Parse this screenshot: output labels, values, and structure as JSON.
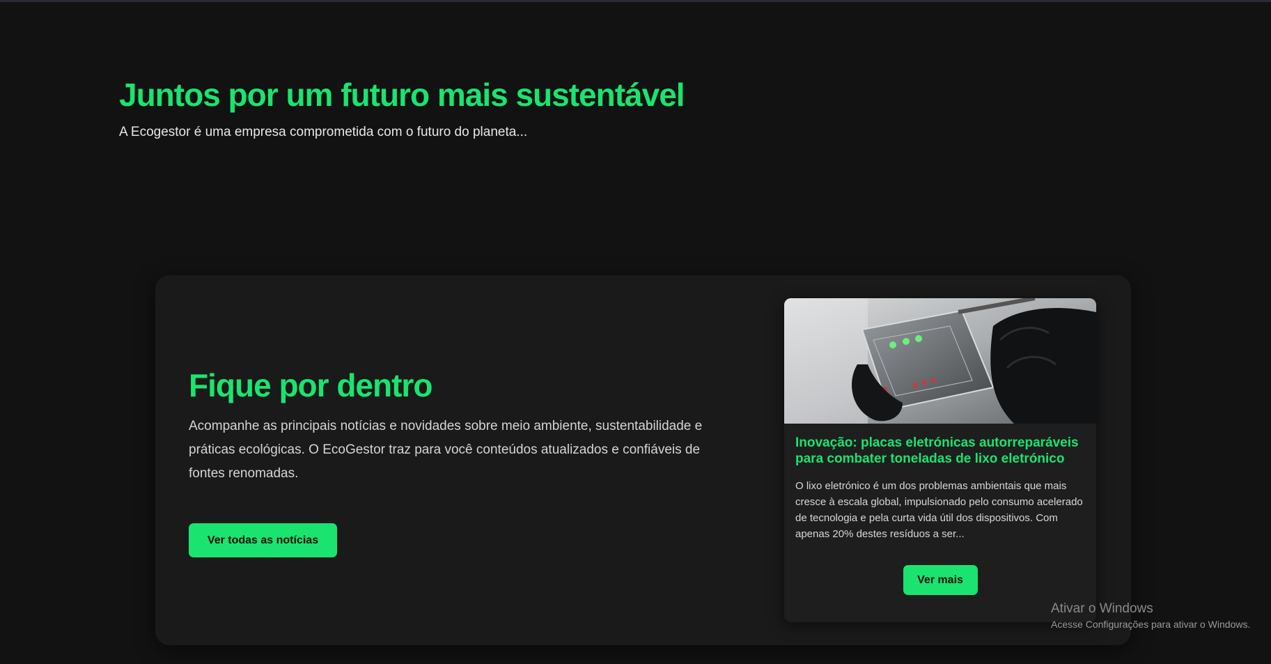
{
  "hero": {
    "title": "Juntos por um futuro mais sustentável",
    "subtitle": "A Ecogestor é uma empresa comprometida com o futuro do planeta..."
  },
  "news_section": {
    "title": "Fique por dentro",
    "description": "Acompanhe as principais notícias e novidades sobre meio ambiente, sustentabilidade e práticas ecológicas. O EcoGestor traz para você conteúdos atualizados e confiáveis de fontes renomadas.",
    "all_news_button": "Ver todas as notícias",
    "card": {
      "image_icon": "circuit-board-photo",
      "title": "Inovação: placas eletrónicas autorreparáveis para combater toneladas de lixo eletrónico",
      "excerpt": "O lixo eletrónico é um dos problemas ambientais que mais cresce à escala global, impulsionado pelo consumo acelerado de tecnologia e pela curta vida útil dos dispositivos. Com apenas 20% destes resíduos a ser...",
      "more_button": "Ver mais"
    }
  },
  "watermark": {
    "title": "Ativar o Windows",
    "subtitle": "Acesse Configurações para ativar o Windows."
  },
  "colors": {
    "accent": "#1ae46f",
    "background": "#121212",
    "panel": "#1a1a1a",
    "card": "#1e1e1e"
  }
}
